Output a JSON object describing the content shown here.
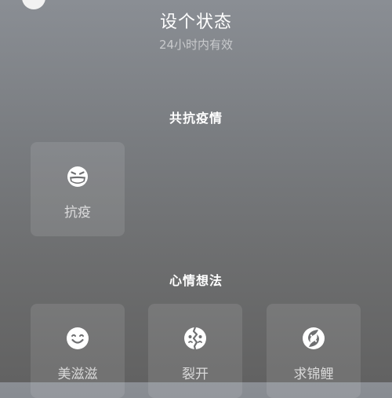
{
  "header": {
    "title": "设个状态",
    "subtitle": "24小时内有效"
  },
  "sections": [
    {
      "title": "共抗疫情",
      "items": [
        {
          "label": "抗疫",
          "icon": "masked-face-icon"
        }
      ]
    },
    {
      "title": "心情想法",
      "items": [
        {
          "label": "美滋滋",
          "icon": "smile-face-icon"
        },
        {
          "label": "裂开",
          "icon": "cracked-face-icon"
        },
        {
          "label": "求锦鲤",
          "icon": "koi-fish-icon"
        }
      ]
    }
  ]
}
